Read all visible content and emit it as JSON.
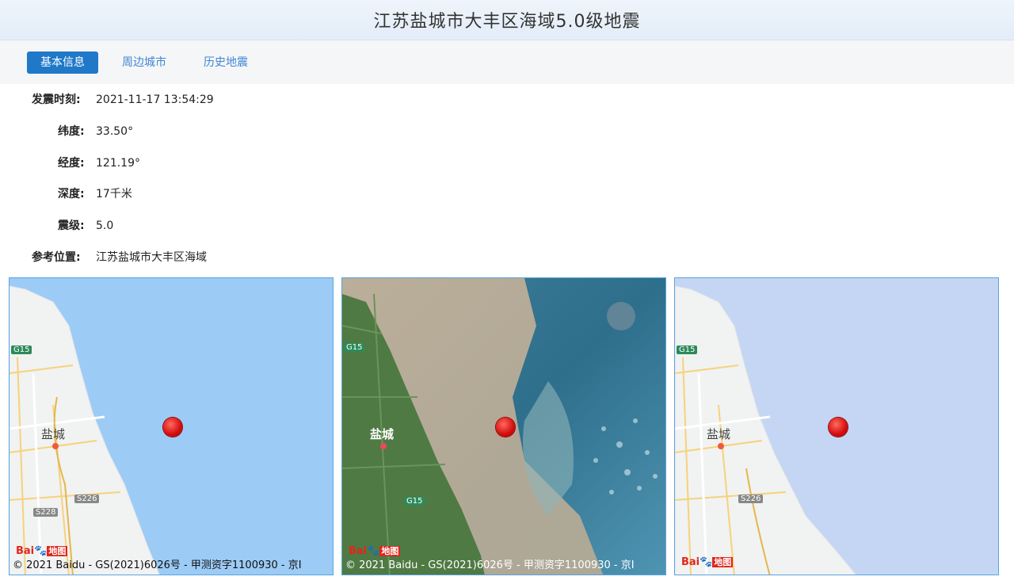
{
  "title": "江苏盐城市大丰区海域5.0级地震",
  "tabs": [
    {
      "label": "基本信息",
      "active": true
    },
    {
      "label": "周边城市",
      "active": false
    },
    {
      "label": "历史地震",
      "active": false
    }
  ],
  "info": [
    {
      "label": "发震时刻:",
      "value": "2021-11-17 13:54:29"
    },
    {
      "label": "纬度:",
      "value": "33.50°"
    },
    {
      "label": "经度:",
      "value": "121.19°"
    },
    {
      "label": "深度:",
      "value": "17千米"
    },
    {
      "label": "震级:",
      "value": "5.0"
    },
    {
      "label": "参考位置:",
      "value": "江苏盐城市大丰区海域"
    }
  ],
  "maps": [
    {
      "type": "road",
      "city": "盐城",
      "signs": [
        "G15",
        "S226",
        "S228"
      ],
      "copyright": "© 2021 Baidu - GS(2021)6026号 - 甲测资字1100930 - 京I"
    },
    {
      "type": "satellite",
      "city": "盐城",
      "signs": [
        "G15",
        "G15"
      ],
      "copyright": "© 2021 Baidu - GS(2021)6026号 - 甲测资字1100930 - 京I"
    },
    {
      "type": "hybrid",
      "city": "盐城",
      "signs": [
        "G15",
        "S226"
      ],
      "copyright": ""
    }
  ],
  "logo": {
    "bai": "Bai",
    "paw": "du",
    "word": "地图"
  },
  "colors": {
    "accent": "#1f78c8",
    "link": "#3e86d6",
    "sea_road": "#9ccbf6",
    "sea_hybrid": "#c4d6f3",
    "epicenter": "#e02020"
  }
}
